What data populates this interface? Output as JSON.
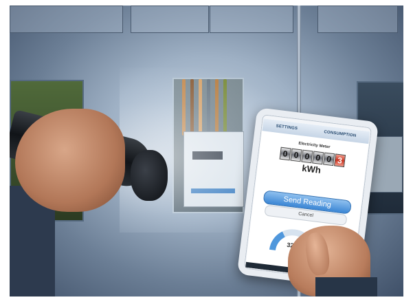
{
  "scene": {
    "subject": "hand-held flashlight and tablet reading an electricity meter",
    "palette": {
      "background": "#ffffff",
      "cabinet": "#9fb1c5",
      "app_accent": "#3a85d4",
      "counter_last_digit": "#c8331f"
    }
  },
  "tablet_app": {
    "tabs": [
      "SETTINGS",
      "CONSUMPTION"
    ],
    "title": "Electricity Meter",
    "counter_digits": [
      "0",
      "0",
      "0",
      "0",
      "0",
      "3"
    ],
    "unit": "kWh",
    "primary_button": "Send Reading",
    "secondary_button": "Cancel",
    "progress_label": "32%",
    "progress_value": 0.32
  }
}
